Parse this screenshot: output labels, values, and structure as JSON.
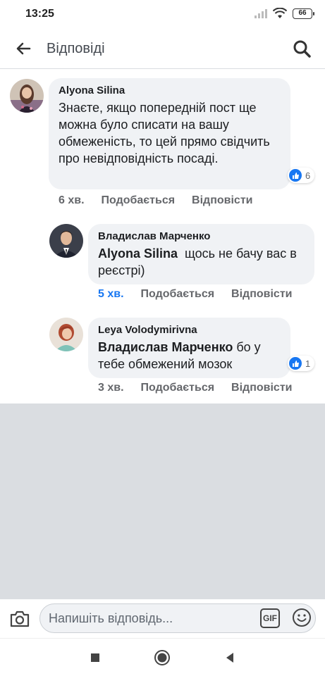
{
  "status_bar": {
    "time": "13:25",
    "battery": "66",
    "icons": [
      "signal-icon",
      "wifi-icon",
      "battery-icon"
    ]
  },
  "header": {
    "title": "Відповіді",
    "back_icon": "arrow-left-icon",
    "search_icon": "search-icon"
  },
  "comments": [
    {
      "author": "Alyona Silina",
      "mention": "",
      "text": "Знаєте, якщо попередній пост ще можна було списати на вашу обмеженість, то цей прямо свідчить про невідповідність посаді.",
      "time": "6 хв.",
      "like_label": "Подобається",
      "reply_label": "Відповісти",
      "reaction_count": "6"
    },
    {
      "author": "Владислав Марченко",
      "mention": "Alyona Silina",
      "text": "щось не бачу вас в реєстрі)",
      "time": "5 хв.",
      "like_label": "Подобається",
      "reply_label": "Відповісти",
      "reaction_count": ""
    },
    {
      "author": "Leya Volodymirivna",
      "mention": "Владислав Марченко",
      "text": "бо у тебе обмежений мозок",
      "time": "3 хв.",
      "like_label": "Подобається",
      "reply_label": "Відповісти",
      "reaction_count": "1"
    }
  ],
  "composer": {
    "placeholder": "Напишіть відповідь...",
    "gif_label": "GIF",
    "camera_icon": "camera-icon",
    "emoji_icon": "smiley-icon"
  },
  "nav_bar": {
    "icons": [
      "square-recents-icon",
      "circle-home-icon",
      "triangle-back-icon"
    ]
  },
  "colors": {
    "accent": "#1877f2",
    "bubble": "#f0f2f5",
    "meta_text": "#65676b",
    "empty_area": "#dadde1"
  }
}
